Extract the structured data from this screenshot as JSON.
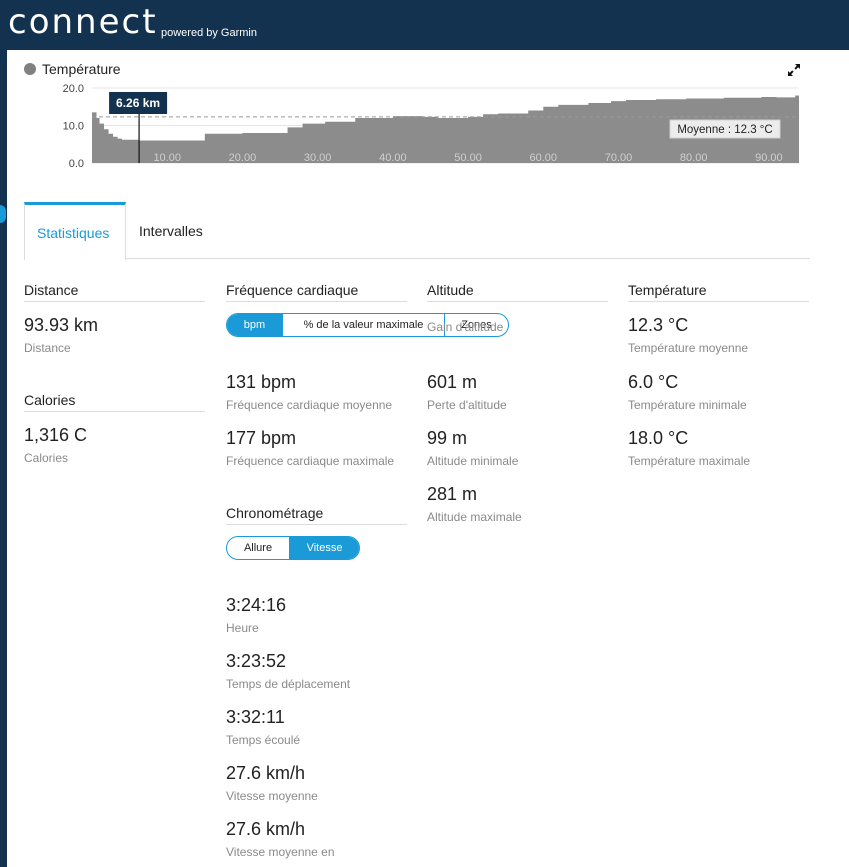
{
  "header": {
    "logo": "connect",
    "logo_sub": "powered by Garmin"
  },
  "chart": {
    "legend": "Température",
    "marker_label": "6.26 km",
    "average_label": "Moyenne : 12.3 °C",
    "icons": {
      "expand": "expand-icon"
    },
    "colors": {
      "area": "#8c8c8c",
      "marker_bg": "#13324f",
      "accent": "#1a9bd7"
    }
  },
  "chart_data": {
    "type": "area",
    "title": "",
    "ylabel": "",
    "xlabel": "",
    "ylim": [
      0,
      20
    ],
    "xlim": [
      0,
      94
    ],
    "y_ticks": [
      "0.0",
      "10.0",
      "20.0"
    ],
    "x_ticks": [
      "10.00",
      "20.00",
      "30.00",
      "40.00",
      "50.00",
      "60.00",
      "70.00",
      "80.00",
      "90.00"
    ],
    "average": 12.3,
    "marker_x": 6.26,
    "series": [
      {
        "x": [
          0,
          0.6,
          1.0,
          1.6,
          2.2,
          2.8,
          3.4,
          4.0,
          6.26,
          10,
          14,
          15,
          20,
          26,
          28,
          31,
          35,
          40,
          44,
          46,
          50,
          52,
          54,
          58,
          60,
          62,
          66,
          69,
          71,
          75,
          79,
          84,
          89,
          91,
          93.5,
          94
        ],
        "y": [
          13.5,
          12.0,
          10.5,
          9.0,
          7.8,
          7.0,
          6.5,
          6.2,
          6.0,
          6.0,
          6.0,
          7.8,
          8.0,
          9.5,
          10.5,
          11.0,
          12.0,
          12.5,
          12.3,
          12.0,
          12.3,
          13.0,
          13.2,
          14.0,
          15.0,
          15.5,
          16.0,
          16.5,
          16.8,
          17.0,
          17.2,
          17.4,
          17.6,
          17.5,
          18.0,
          18.0
        ]
      }
    ]
  },
  "tabs": [
    {
      "label": "Statistiques"
    },
    {
      "label": "Intervalles"
    }
  ],
  "distance": {
    "title": "Distance",
    "value": "93.93 km",
    "label": "Distance"
  },
  "calories": {
    "title": "Calories",
    "value": "1,316 C",
    "label": "Calories"
  },
  "heart": {
    "title": "Fréquence cardiaque",
    "seg": [
      "bpm",
      "% de la valeur maximale",
      "Zones"
    ],
    "avg_value": "131 bpm",
    "avg_label": "Fréquence cardiaque moyenne",
    "max_value": "177 bpm",
    "max_label": "Fréquence cardiaque maximale"
  },
  "timing": {
    "title": "Chronométrage",
    "seg": [
      "Allure",
      "Vitesse"
    ],
    "items": [
      {
        "value": "3:24:16",
        "label": "Heure"
      },
      {
        "value": "3:23:52",
        "label": "Temps de déplacement"
      },
      {
        "value": "3:32:11",
        "label": "Temps écoulé"
      },
      {
        "value": "27.6 km/h",
        "label": "Vitesse moyenne"
      },
      {
        "value": "27.6 km/h",
        "label": "Vitesse moyenne en"
      }
    ]
  },
  "altitude": {
    "title": "Altitude",
    "items": [
      {
        "value": "",
        "label": "Gain d'altitude"
      },
      {
        "value": "601 m",
        "label": "Perte d'altitude"
      },
      {
        "value": "99 m",
        "label": "Altitude minimale"
      },
      {
        "value": "281 m",
        "label": "Altitude maximale"
      }
    ]
  },
  "temperature": {
    "title": "Température",
    "items": [
      {
        "value": "12.3 °C",
        "label": "Température moyenne"
      },
      {
        "value": "6.0 °C",
        "label": "Température minimale"
      },
      {
        "value": "18.0 °C",
        "label": "Température maximale"
      }
    ]
  }
}
